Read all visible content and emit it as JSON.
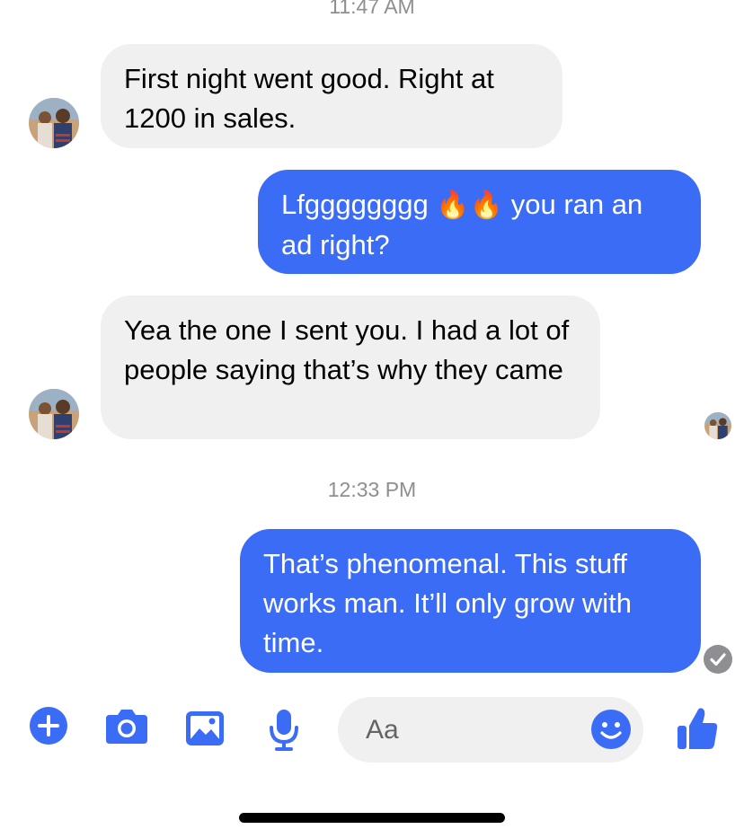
{
  "timestamps": [
    "11:47 AM",
    "12:33 PM"
  ],
  "messages": [
    {
      "sender": "contact",
      "text": "First night went good. Right at 1200 in sales."
    },
    {
      "sender": "me",
      "text_before": "Lfgggggggg",
      "emoji": "🔥🔥",
      "text_after": "you ran an ad right?"
    },
    {
      "sender": "contact",
      "text": "Yea the one I sent you. I had a lot of people saying that’s why they came"
    },
    {
      "sender": "me",
      "text": "That’s phenomenal. This stuff works man. It’ll only grow with time."
    }
  ],
  "composer": {
    "placeholder": "Aa",
    "icons": [
      "plus-icon",
      "camera-icon",
      "image-icon",
      "microphone-icon",
      "emoji-icon",
      "thumbs-up-icon"
    ]
  },
  "colors": {
    "accent": "#3b6cf6",
    "incoming_bubble": "#f0f0f0",
    "timestamp": "#8e8e93"
  }
}
